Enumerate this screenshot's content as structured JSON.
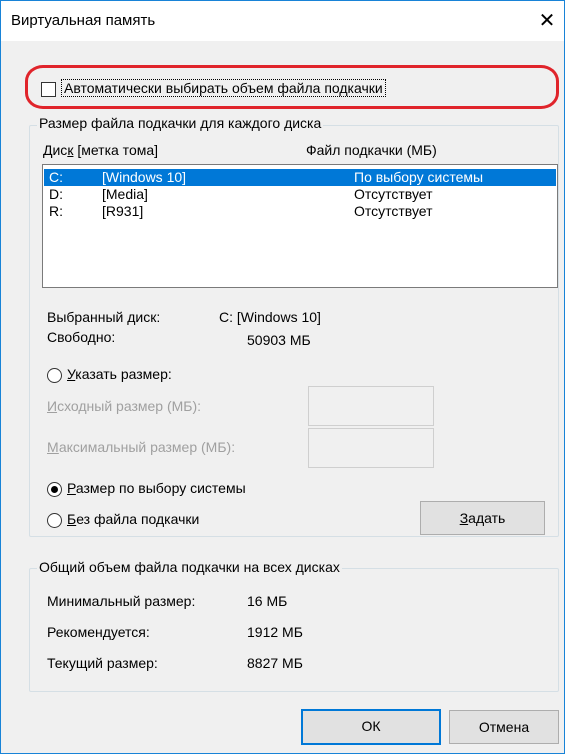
{
  "window": {
    "title": "Виртуальная память",
    "close_glyph": "✕"
  },
  "auto": {
    "label": "Автоматически выбирать объем файла подкачки",
    "checked": false
  },
  "per_disk": {
    "group_title": "Размер файла подкачки для каждого диска",
    "col_disk": "Диск [метка тома]",
    "col_disk_mnemonic": "к",
    "col_pagefile": "Файл подкачки (МБ)",
    "rows": [
      {
        "drive": "C:",
        "label": "[Windows 10]",
        "pagefile": "По выбору системы",
        "selected": true
      },
      {
        "drive": "D:",
        "label": "[Media]",
        "pagefile": "Отсутствует",
        "selected": false
      },
      {
        "drive": "R:",
        "label": "[R931]",
        "pagefile": "Отсутствует",
        "selected": false
      }
    ],
    "selected_disk_label": "Выбранный диск:",
    "selected_disk_value": "C:  [Windows 10]",
    "free_label": "Свободно:",
    "free_value": "50903 МБ",
    "custom_size": "Указать размер:",
    "initial_size": "Исходный размер (МБ):",
    "max_size": "Максимальный размер (МБ):",
    "system_managed": "Размер по выбору системы",
    "no_pagefile": "Без файла подкачки",
    "set_button": "Задать",
    "selected_option": "system_managed"
  },
  "total": {
    "group_title": "Общий объем файла подкачки на всех дисках",
    "min_label": "Минимальный размер:",
    "min_value": "16 МБ",
    "recommended_label": "Рекомендуется:",
    "recommended_value": "1912 МБ",
    "current_label": "Текущий размер:",
    "current_value": "8827 МБ"
  },
  "buttons": {
    "ok": "ОК",
    "cancel": "Отмена"
  },
  "colors": {
    "selection": "#0078d7",
    "highlight_ring": "#e0242b",
    "window_border": "#1883d7"
  }
}
